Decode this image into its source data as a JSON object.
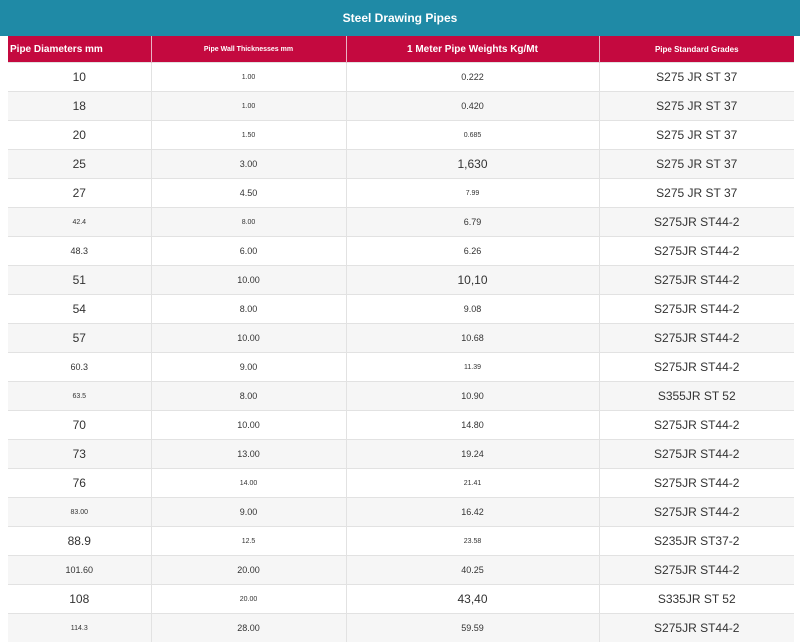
{
  "title": "Steel Drawing Pipes",
  "headers": [
    "Pipe Diameters mm",
    "Pipe Wall Thicknesses mm",
    "1 Meter Pipe Weights Kg/Mt",
    "Pipe Standard Grades"
  ],
  "rows": [
    [
      "10",
      "1.00",
      "0.222",
      "S275 JR ST 37"
    ],
    [
      "18",
      "1.00",
      "0.420",
      "S275 JR ST 37"
    ],
    [
      "20",
      "1.50",
      "0.685",
      "S275 JR ST 37"
    ],
    [
      "25",
      "3.00",
      "1,630",
      "S275 JR ST 37"
    ],
    [
      "27",
      "4.50",
      "7.99",
      "S275 JR ST 37"
    ],
    [
      "42.4",
      "8.00",
      "6.79",
      "S275JR ST44-2"
    ],
    [
      "48.3",
      "6.00",
      "6.26",
      "S275JR ST44-2"
    ],
    [
      "51",
      "10.00",
      "10,10",
      "S275JR ST44-2"
    ],
    [
      "54",
      "8.00",
      "9.08",
      "S275JR ST44-2"
    ],
    [
      "57",
      "10.00",
      "10.68",
      "S275JR ST44-2"
    ],
    [
      "60.3",
      "9.00",
      "11.39",
      "S275JR ST44-2"
    ],
    [
      "63.5",
      "8.00",
      "10.90",
      "S355JR ST 52"
    ],
    [
      "70",
      "10.00",
      "14.80",
      "S275JR ST44-2"
    ],
    [
      "73",
      "13.00",
      "19.24",
      "S275JR ST44-2"
    ],
    [
      "76",
      "14.00",
      "21.41",
      "S275JR ST44-2"
    ],
    [
      "83.00",
      "9.00",
      "16.42",
      "S275JR ST44-2"
    ],
    [
      "88.9",
      "12.5",
      "23.58",
      "S235JR ST37-2"
    ],
    [
      "101.60",
      "20.00",
      "40.25",
      "S275JR ST44-2"
    ],
    [
      "108",
      "20.00",
      "43,40",
      "S335JR ST 52"
    ],
    [
      "114.3",
      "28.00",
      "59.59",
      "S275JR ST44-2"
    ]
  ]
}
